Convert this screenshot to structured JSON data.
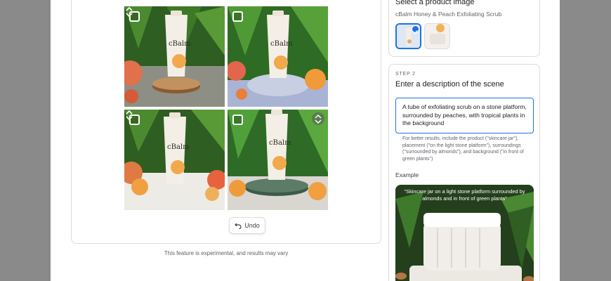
{
  "step1": {
    "heading": "Select a product image",
    "product_name": "cBalm Honey & Peach Exfoliating Scrub",
    "selected_index": 0
  },
  "step2": {
    "kicker": "STEP 2",
    "heading": "Enter a description of the scene",
    "scene_value": "A tube of exfoliating scrub on a stone platform, surrounded by peaches, with tropical plants in the background",
    "hint": "For better results, include the product (\"skincare jar\"), placement (\"on the light stone platform\"), surroundings (\"surrounded by almonds\"), and background (\"in front of green plants\")",
    "example_label": "Example",
    "example_caption": "\"Skincare jar on a light stone platform surrounded by almonds and in front of green plants\""
  },
  "grid": {
    "brand_on_tube": "cBalm",
    "tiles": [
      {
        "name": "generated-image-1",
        "checked": false
      },
      {
        "name": "generated-image-2",
        "checked": false
      },
      {
        "name": "generated-image-3",
        "checked": false
      },
      {
        "name": "generated-image-4",
        "checked": false
      }
    ]
  },
  "undo_label": "Undo",
  "disclaimer": "This feature is experimental, and results may vary",
  "colors": {
    "accent": "#1a73e8",
    "border": "#dadce0",
    "backdrop": "#8a8a8a"
  },
  "icons": [
    "checkbox-icon",
    "drag-handle-icon",
    "undo-icon",
    "checkmark-icon"
  ]
}
